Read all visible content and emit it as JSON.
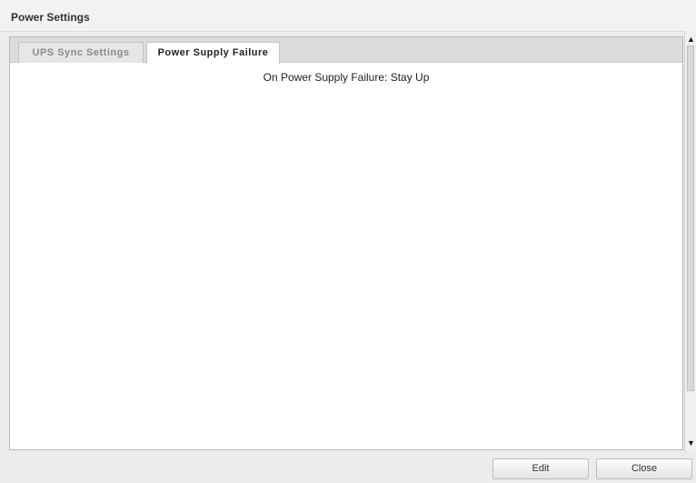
{
  "window": {
    "title": "Power Settings"
  },
  "tabs": [
    {
      "label": "UPS Sync Settings",
      "active": false
    },
    {
      "label": "Power Supply Failure",
      "active": true
    }
  ],
  "content": {
    "status_text": "On Power Supply Failure: Stay Up"
  },
  "scrollbar": {
    "up_arrow": "▲",
    "down_arrow": "▼"
  },
  "footer": {
    "edit_label": "Edit",
    "close_label": "Close"
  }
}
